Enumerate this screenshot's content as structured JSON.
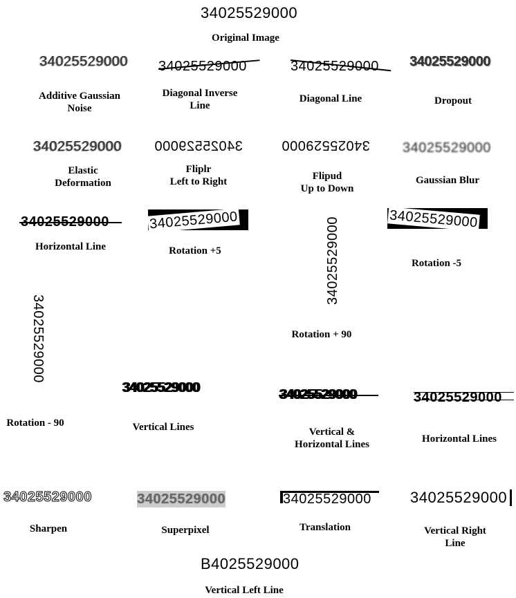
{
  "number": "34025529000",
  "num_flipped": "34025529000",
  "num_vertical_left": "B4025529000",
  "captions": {
    "original": "Original Image",
    "gauss_noise": "Additive Gaussian\nNoise",
    "diag_inverse": "Diagonal Inverse\nLine",
    "diag_line": "Diagonal Line",
    "dropout": "Dropout",
    "elastic": "Elastic\nDeformation",
    "fliplr": "Fliplr\nLeft to Right",
    "flipud": "Flipud\nUp to Down",
    "gauss_blur": "Gaussian Blur",
    "horiz_line": "Horizontal Line",
    "rot_p5": "Rotation +5",
    "rot_m5": "Rotation -5",
    "rot_p90": "Rotation + 90",
    "rot_m90": "Rotation - 90",
    "vert_lines": "Vertical Lines",
    "vh_lines": "Vertical &\nHorizontal Lines",
    "horiz_lines": "Horizontal Lines",
    "sharpen": "Sharpen",
    "superpixel": "Superpixel",
    "translation": "Translation",
    "vert_right": "Vertical Right\nLine",
    "vert_left": "Vertical Left Line"
  }
}
